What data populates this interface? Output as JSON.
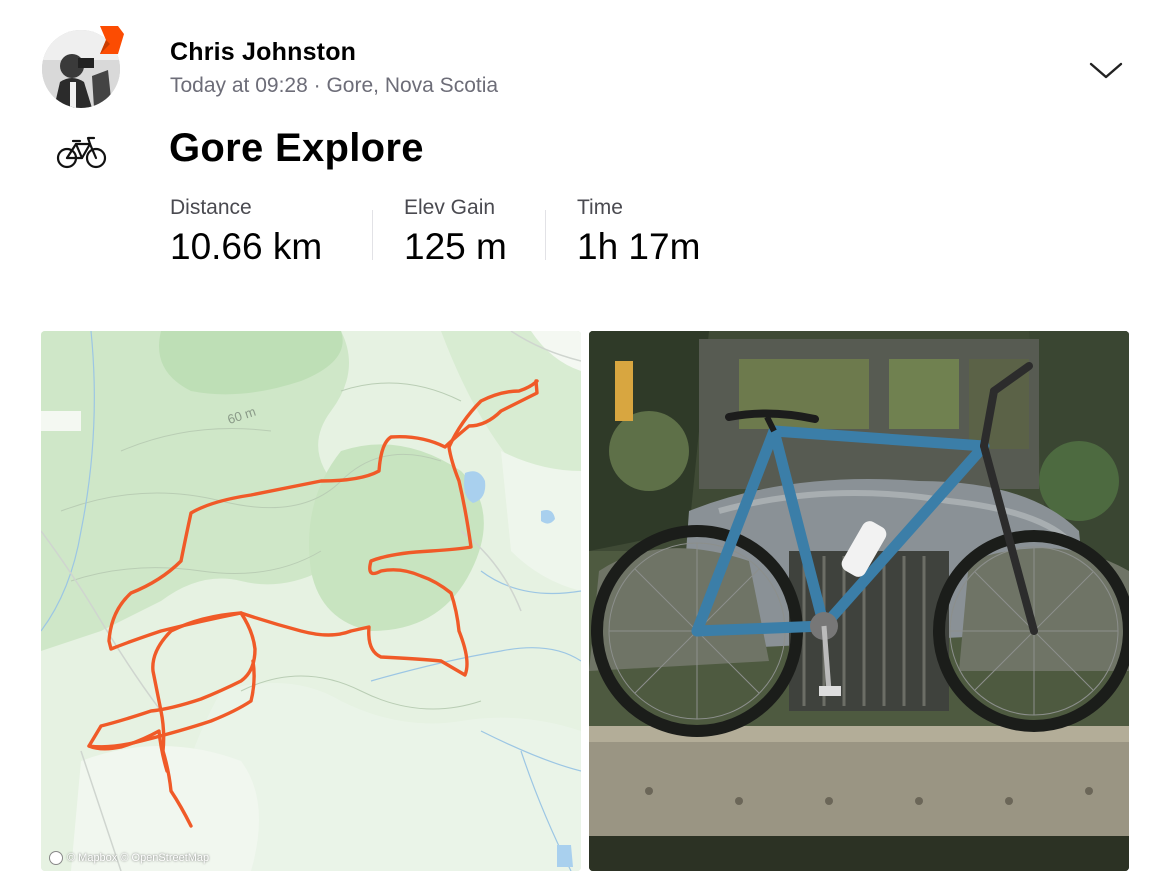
{
  "athlete": {
    "name": "Chris Johnston",
    "timestamp": "Today at 09:28",
    "separator": "·",
    "location": "Gore, Nova Scotia"
  },
  "activity": {
    "title": "Gore Explore",
    "sport": "bike-icon"
  },
  "stats": [
    {
      "label": "Distance",
      "value": "10.66 km"
    },
    {
      "label": "Elev Gain",
      "value": "125 m"
    },
    {
      "label": "Time",
      "value": "1h 17m"
    }
  ],
  "map": {
    "contour_label": "60 m",
    "attribution": "© Mapbox © OpenStreetMap",
    "route_color": "#f05a28"
  },
  "colors": {
    "accent": "#fc4c02",
    "secondary_text": "#6d6d78"
  },
  "icons": [
    "strava-badge-icon",
    "bike-icon",
    "chevron-down-icon",
    "mapbox-logo-icon"
  ]
}
